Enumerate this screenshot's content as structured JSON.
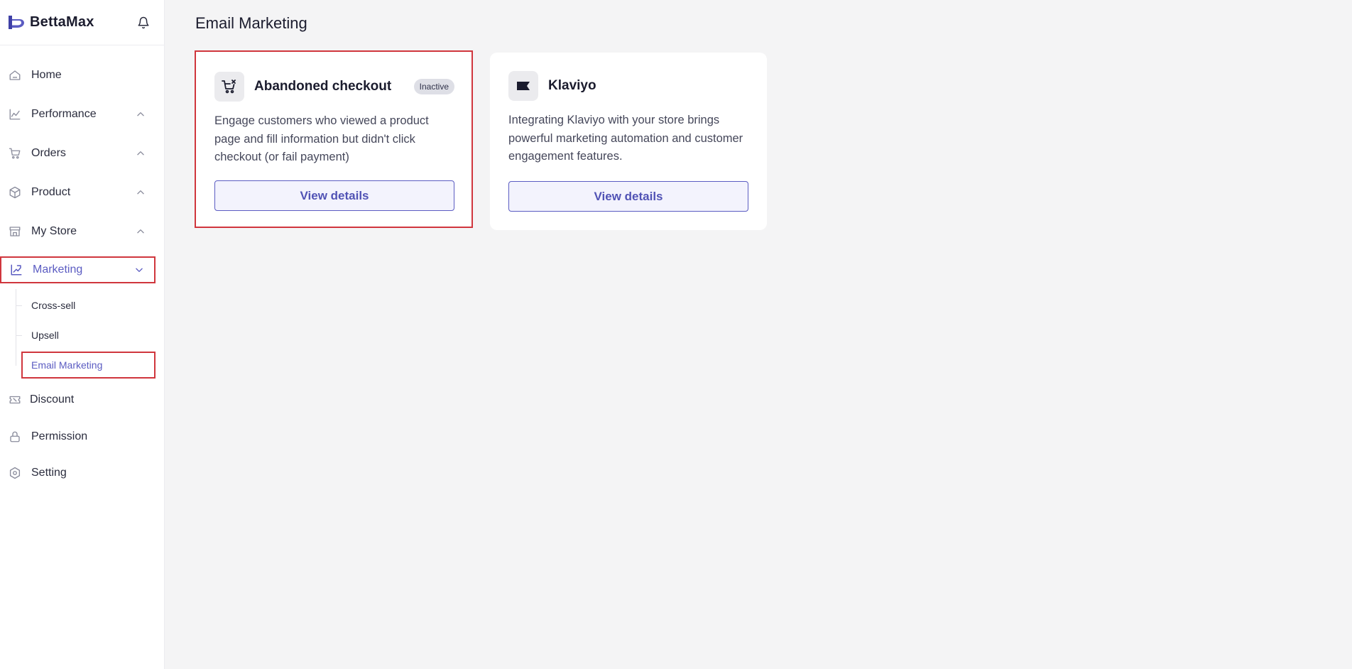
{
  "brand": {
    "name": "BettaMax",
    "accent": "#5b5cc2"
  },
  "sidebar": {
    "items": [
      {
        "label": "Home",
        "icon": "home-icon"
      },
      {
        "label": "Performance",
        "icon": "chart-icon"
      },
      {
        "label": "Orders",
        "icon": "cart-icon"
      },
      {
        "label": "Product",
        "icon": "box-icon"
      },
      {
        "label": "My Store",
        "icon": "store-icon"
      },
      {
        "label": "Marketing",
        "icon": "marketing-icon"
      },
      {
        "label": "Discount",
        "icon": "ticket-icon"
      },
      {
        "label": "Permission",
        "icon": "lock-icon"
      },
      {
        "label": "Setting",
        "icon": "gear-icon"
      }
    ],
    "marketing_sub": [
      {
        "label": "Cross-sell"
      },
      {
        "label": "Upsell"
      },
      {
        "label": "Email Marketing"
      }
    ]
  },
  "main": {
    "title": "Email Marketing",
    "cards": [
      {
        "title": "Abandoned checkout",
        "badge": "Inactive",
        "description": "Engage customers who viewed a product page and fill information but didn't click checkout (or fail payment)",
        "button": "View details"
      },
      {
        "title": "Klaviyo",
        "description": "Integrating Klaviyo with your store brings powerful marketing automation and customer engagement features.",
        "button": "View details"
      }
    ]
  }
}
